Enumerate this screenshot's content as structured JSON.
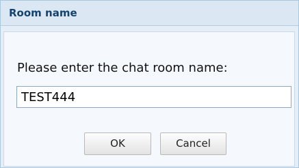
{
  "dialog": {
    "title": "Room name",
    "prompt": "Please enter the chat room name:",
    "room_name_value": "TEST444",
    "ok_label": "OK",
    "cancel_label": "Cancel"
  }
}
